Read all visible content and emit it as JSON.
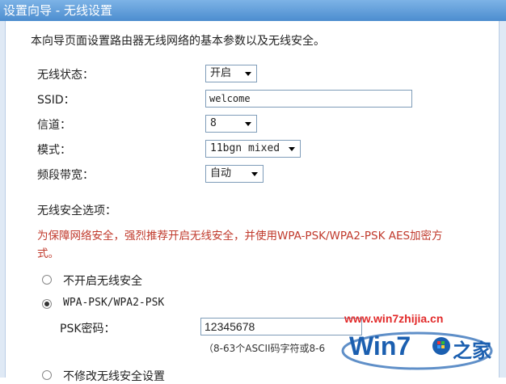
{
  "window": {
    "title": "设置向导 - 无线设置"
  },
  "intro": "本向导页面设置路由器无线网络的基本参数以及无线安全。",
  "fields": {
    "wireless_status": {
      "label": "无线状态：",
      "value": "开启"
    },
    "ssid": {
      "label": "SSID：",
      "value": "welcome"
    },
    "channel": {
      "label": "信道：",
      "value": "8"
    },
    "mode": {
      "label": "模式：",
      "value": "11bgn mixed"
    },
    "bandwidth": {
      "label": "频段带宽：",
      "value": "自动"
    }
  },
  "security": {
    "heading": "无线安全选项：",
    "warning_line1": "为保障网络安全，强烈推荐开启无线安全，并使用WPA-PSK/WPA2-PSK AES加密方",
    "warning_line2": "式。",
    "option_off": "不开启无线安全",
    "option_wpa": "WPA-PSK/WPA2-PSK",
    "psk_label": "PSK密码：",
    "psk_value": "12345678",
    "psk_hint": "（8-63个ASCII码字符或8-6",
    "option_nochange": "不修改无线安全设置"
  },
  "watermark": {
    "url": "www.win7zhijia.cn",
    "logo_text": "Win7",
    "logo_suffix": "之家"
  },
  "colors": {
    "titlebar": "#4c8dcf",
    "warning": "#c0392b",
    "watermark": "#e22a2a",
    "logo_blue": "#1b5fb0"
  },
  "icons": {
    "dropdown": "chevron-down-icon",
    "radio": "radio-icon"
  }
}
